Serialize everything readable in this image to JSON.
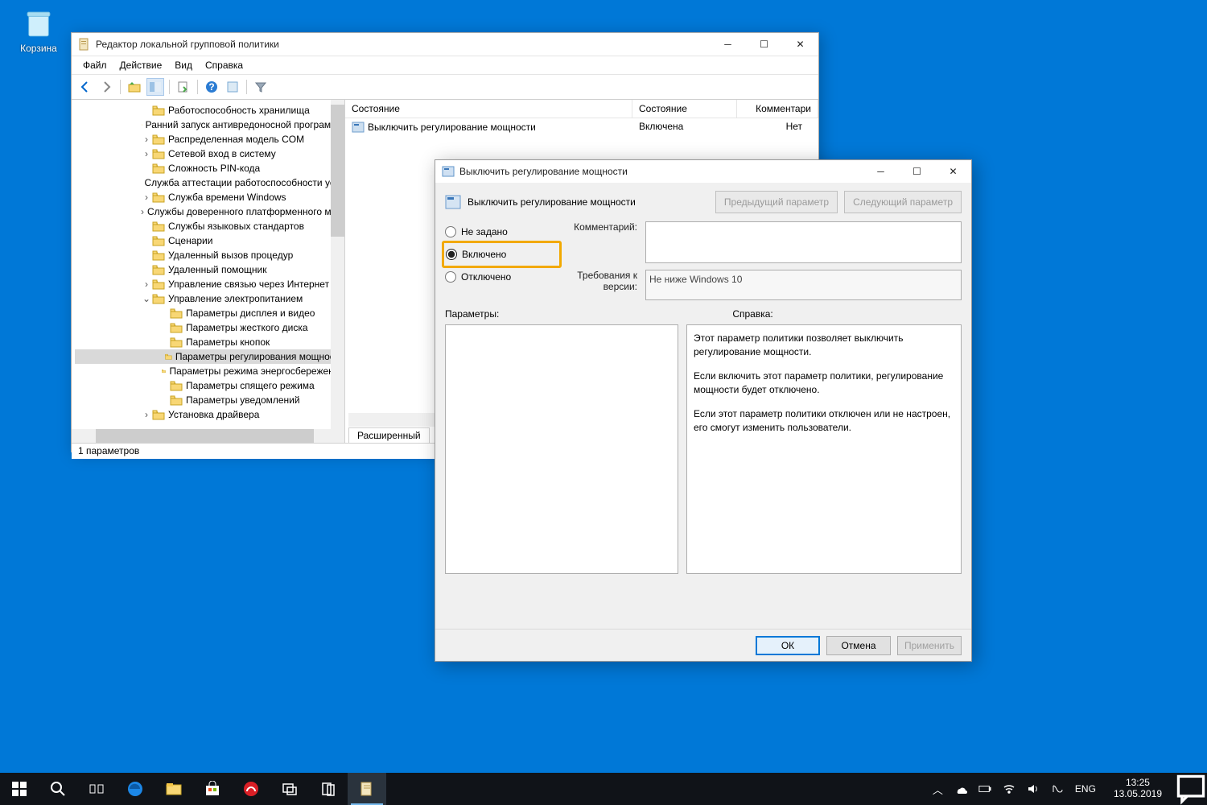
{
  "desktop": {
    "recycleBin": "Корзина"
  },
  "gpedit": {
    "title": "Редактор локальной групповой политики",
    "menu": [
      "Файл",
      "Действие",
      "Вид",
      "Справка"
    ],
    "tree": [
      {
        "indent": 1,
        "name": "Работоспособность хранилища"
      },
      {
        "indent": 1,
        "name": "Ранний запуск антивредоносной программы"
      },
      {
        "indent": 1,
        "name": "Распределенная модель COM",
        "exp": ">"
      },
      {
        "indent": 1,
        "name": "Сетевой вход в систему",
        "exp": ">"
      },
      {
        "indent": 1,
        "name": "Сложность PIN-кода"
      },
      {
        "indent": 1,
        "name": "Служба аттестации работоспособности устр"
      },
      {
        "indent": 1,
        "name": "Служба времени Windows",
        "exp": ">"
      },
      {
        "indent": 1,
        "name": "Службы доверенного платформенного моду",
        "exp": ">"
      },
      {
        "indent": 1,
        "name": "Службы языковых стандартов"
      },
      {
        "indent": 1,
        "name": "Сценарии"
      },
      {
        "indent": 1,
        "name": "Удаленный вызов процедур"
      },
      {
        "indent": 1,
        "name": "Удаленный помощник"
      },
      {
        "indent": 1,
        "name": "Управление связью через Интернет",
        "exp": ">"
      },
      {
        "indent": 1,
        "name": "Управление электропитанием",
        "exp": "v"
      },
      {
        "indent": 2,
        "name": "Параметры дисплея и видео"
      },
      {
        "indent": 2,
        "name": "Параметры жесткого диска"
      },
      {
        "indent": 2,
        "name": "Параметры кнопок"
      },
      {
        "indent": 2,
        "name": "Параметры регулирования мощности",
        "sel": true
      },
      {
        "indent": 2,
        "name": "Параметры режима энергосбережения"
      },
      {
        "indent": 2,
        "name": "Параметры спящего режима"
      },
      {
        "indent": 2,
        "name": "Параметры уведомлений"
      },
      {
        "indent": 1,
        "name": "Установка драйвера",
        "exp": ">"
      }
    ],
    "listHead": {
      "c1": "Состояние",
      "c2": "Состояние",
      "c3": "Комментари"
    },
    "listRow": {
      "name": "Выключить регулирование мощности",
      "state": "Включена",
      "comment": "Нет"
    },
    "tab": "Расширенный",
    "status": "1 параметров"
  },
  "dlg": {
    "title": "Выключить регулирование мощности",
    "heading": "Выключить регулирование мощности",
    "prevBtn": "Предыдущий параметр",
    "nextBtn": "Следующий параметр",
    "radios": {
      "r0": "Не задано",
      "r1": "Включено",
      "r2": "Отключено"
    },
    "commentLabel": "Комментарий:",
    "versionLabel": "Требования к версии:",
    "versionText": "Не ниже Windows 10",
    "paramsLabel": "Параметры:",
    "helpLabel": "Справка:",
    "help": {
      "p1": "Этот параметр политики позволяет выключить регулирование мощности.",
      "p2": "Если включить этот параметр политики, регулирование мощности будет отключено.",
      "p3": "Если этот параметр политики отключен или не настроен, его смогут изменить пользователи."
    },
    "buttons": {
      "ok": "ОК",
      "cancel": "Отмена",
      "apply": "Применить"
    }
  },
  "taskbar": {
    "lang": "ENG",
    "time": "13:25",
    "date": "13.05.2019"
  }
}
